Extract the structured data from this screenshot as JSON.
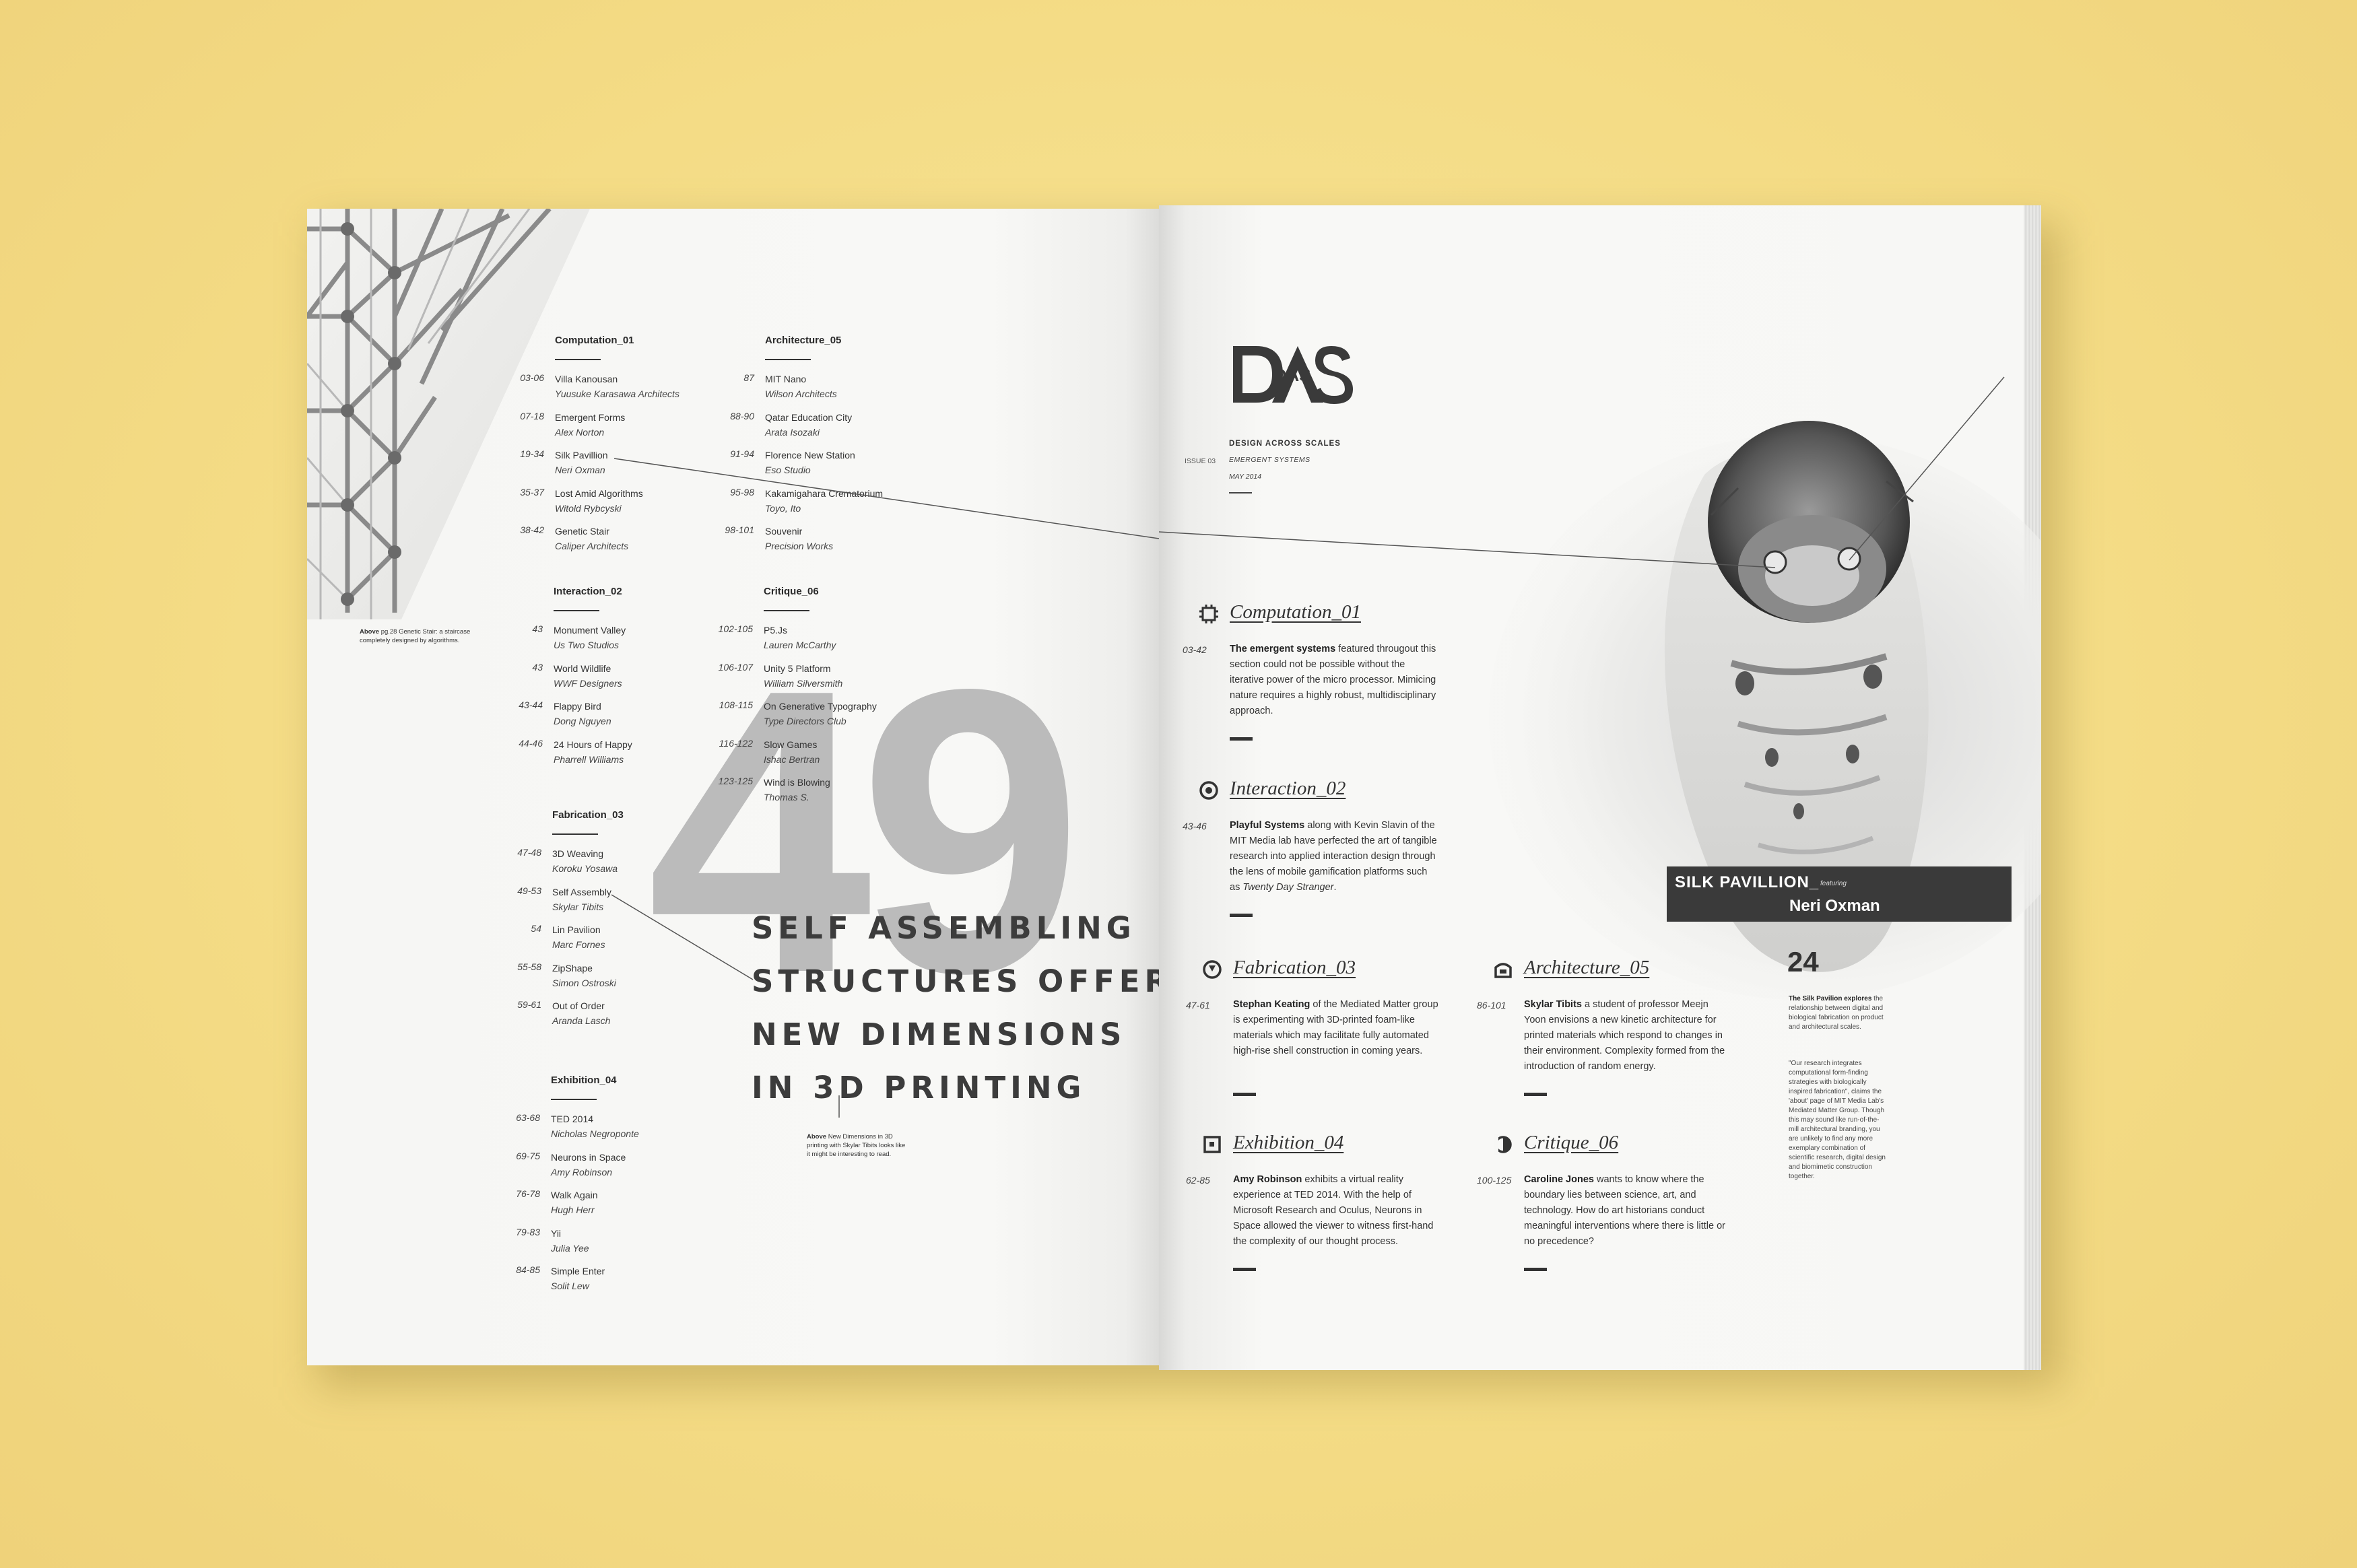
{
  "left": {
    "photo_caption": {
      "lead": "Above",
      "text": "pg.28 Genetic Stair: a staircase completely designed by algorithms."
    },
    "sections": [
      {
        "title": "Computation_01",
        "items": [
          {
            "pages": "03-06",
            "title": "Villa Kanousan",
            "sub": "Yuusuke Karasawa Architects"
          },
          {
            "pages": "07-18",
            "title": "Emergent Forms",
            "sub": "Alex Norton"
          },
          {
            "pages": "19-34",
            "title": "Silk Pavillion",
            "sub": "Neri Oxman"
          },
          {
            "pages": "35-37",
            "title": "Lost Amid Algorithms",
            "sub": "Witold Rybcyski"
          },
          {
            "pages": "38-42",
            "title": "Genetic Stair",
            "sub": "Caliper Architects"
          }
        ]
      },
      {
        "title": "Interaction_02",
        "items": [
          {
            "pages": "43",
            "title": "Monument Valley",
            "sub": "Us Two Studios"
          },
          {
            "pages": "43",
            "title": "World Wildlife",
            "sub": "WWF Designers"
          },
          {
            "pages": "43-44",
            "title": "Flappy Bird",
            "sub": "Dong Nguyen"
          },
          {
            "pages": "44-46",
            "title": "24 Hours of Happy",
            "sub": "Pharrell Williams"
          }
        ]
      },
      {
        "title": "Fabrication_03",
        "items": [
          {
            "pages": "47-48",
            "title": "3D Weaving",
            "sub": "Koroku Yosawa"
          },
          {
            "pages": "49-53",
            "title": "Self Assembly",
            "sub": "Skylar Tibits"
          },
          {
            "pages": "54",
            "title": "Lin Pavilion",
            "sub": "Marc Fornes"
          },
          {
            "pages": "55-58",
            "title": "ZipShape",
            "sub": "Simon Ostroski"
          },
          {
            "pages": "59-61",
            "title": "Out of Order",
            "sub": "Aranda Lasch"
          }
        ]
      },
      {
        "title": "Exhibition_04",
        "items": [
          {
            "pages": "63-68",
            "title": "TED 2014",
            "sub": "Nicholas Negroponte"
          },
          {
            "pages": "69-75",
            "title": "Neurons in Space",
            "sub": "Amy Robinson"
          },
          {
            "pages": "76-78",
            "title": "Walk Again",
            "sub": "Hugh Herr"
          },
          {
            "pages": "79-83",
            "title": "Yii",
            "sub": "Julia Yee"
          },
          {
            "pages": "84-85",
            "title": "Simple Enter",
            "sub": "Solit Lew"
          }
        ]
      },
      {
        "title": "Architecture_05",
        "items": [
          {
            "pages": "87",
            "title": "MIT Nano",
            "sub": "Wilson Architects"
          },
          {
            "pages": "88-90",
            "title": "Qatar Education City",
            "sub": "Arata Isozaki"
          },
          {
            "pages": "91-94",
            "title": "Florence New Station",
            "sub": "Eso Studio"
          },
          {
            "pages": "95-98",
            "title": "Kakamigahara Crematorium",
            "sub": "Toyo, Ito"
          },
          {
            "pages": "98-101",
            "title": "Souvenir",
            "sub": "Precision Works"
          }
        ]
      },
      {
        "title": "Critique_06",
        "items": [
          {
            "pages": "102-105",
            "title": "P5.Js",
            "sub": "Lauren McCarthy"
          },
          {
            "pages": "106-107",
            "title": "Unity 5 Platform",
            "sub": "William Silversmith"
          },
          {
            "pages": "108-115",
            "title": "On Generative Typography",
            "sub": "Type Directors Club"
          },
          {
            "pages": "116-122",
            "title": "Slow Games",
            "sub": "Ishac Bertran"
          },
          {
            "pages": "123-125",
            "title": "Wind is Blowing",
            "sub": "Thomas S."
          }
        ]
      }
    ],
    "big_number": "49",
    "headline": [
      "SELF ASSEMBLING",
      "STRUCTURES OFFER",
      "NEW DIMENSIONS",
      "IN 3D PRINTING"
    ],
    "headline_caption": {
      "lead": "Above",
      "text": "New Dimensions in 3D printing with Skylar Tibits looks like it might be interesting to read."
    }
  },
  "right": {
    "logo": "DAS",
    "masthead": {
      "title": "DESIGN ACROSS SCALES",
      "issue": "ISSUE 03",
      "subtitle": "EMERGENT SYSTEMS",
      "date": "MAY 2014"
    },
    "banner": {
      "title": "SILK PAVILLION_",
      "featuring": "featuring",
      "name": "Neri Oxman"
    },
    "sections": [
      {
        "title": "Computation_01",
        "pages": "03-42",
        "icon": "chip-icon",
        "lead": "The emergent systems",
        "body": " featured througout this section could not be possible without the iterative power of the micro processor. Mimicing nature requires a highly robust, multidisciplinary approach."
      },
      {
        "title": "Interaction_02",
        "pages": "43-46",
        "icon": "target-icon",
        "lead": "Playful Systems",
        "body": " along with Kevin Slavin of the MIT Media lab have perfected the art of tangible research into applied interaction design through the lens of mobile gamification platforms such as ",
        "italic": "Twenty Day Stranger",
        "tail": "."
      },
      {
        "title": "Fabrication_03",
        "pages": "47-61",
        "icon": "nozzle-icon",
        "lead": "Stephan Keating",
        "body": " of the Mediated Matter group is experimenting with 3D-printed foam-like materials which may facilitate fully automated high-rise shell construction in coming years."
      },
      {
        "title": "Architecture_05",
        "pages": "86-101",
        "icon": "building-icon",
        "lead": "Skylar Tibits",
        "body": " a student of professor Meejn Yoon envisions a new kinetic architecture for printed materials which respond to changes in their environment. Complexity formed from the introduction of random energy."
      },
      {
        "title": "Exhibition_04",
        "pages": "62-85",
        "icon": "frame-icon",
        "lead": "Amy Robinson",
        "body": " exhibits a virtual reality experience at TED 2014. With the help of Microsoft Research and Oculus, Neurons in Space allowed the viewer to witness first-hand the complexity of our thought process."
      },
      {
        "title": "Critique_06",
        "pages": "100-125",
        "icon": "half-circle-icon",
        "lead": "Caroline Jones",
        "body": " wants to know where the boundary lies between science, art, and technology. How do art historians conduct meaningful interventions where there is little or no precedence?"
      }
    ],
    "sidebar": {
      "number": "24",
      "lead": "The Silk Pavilion explores",
      "intro": " the relationship between digital and biological fabrication on product and architectural scales.",
      "quote": "\"Our research integrates computational form-finding strategies with biologically inspired fabrication\", claims the 'about' page of MIT Media Lab's Mediated Matter Group. Though this may sound like run-of-the-mill architectural branding, you are unlikely to find any more exemplary combination of scientific research, digital design and biomimetic construction together."
    }
  },
  "colors": {
    "background": "#f5df8c",
    "paper": "#f7f7f5",
    "ink": "#333333",
    "big_number": "#bbbbbb",
    "banner": "#3a3a3a"
  }
}
